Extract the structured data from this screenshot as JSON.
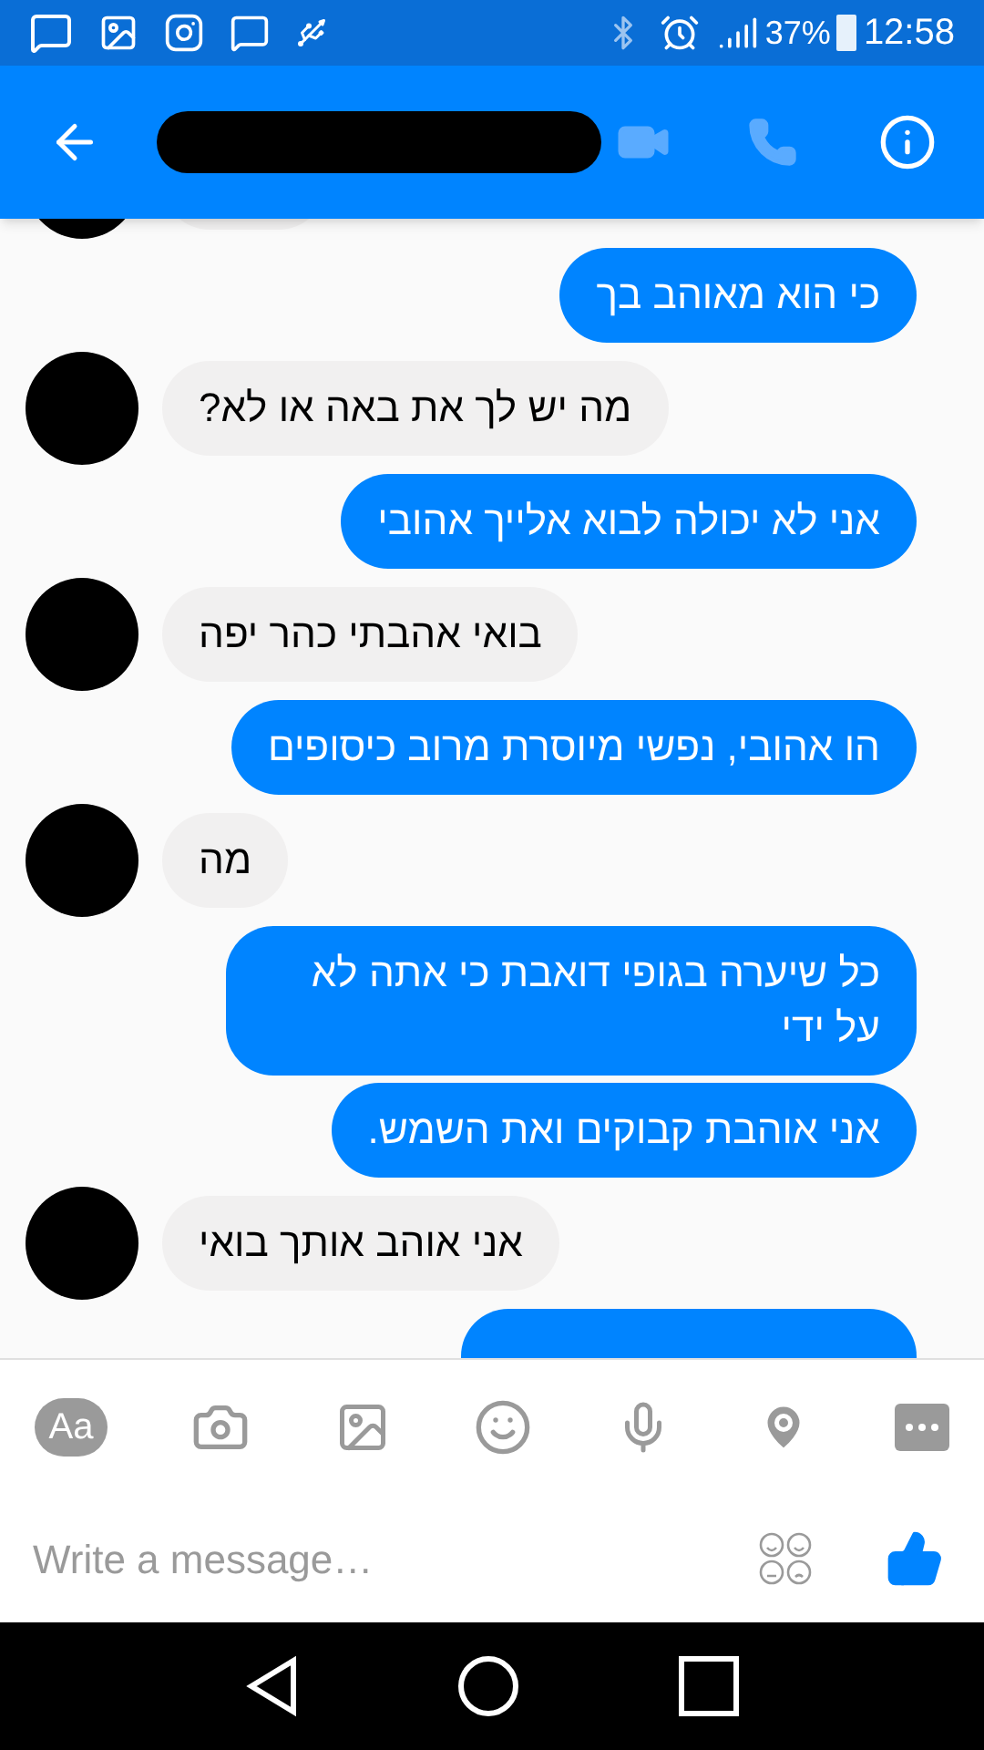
{
  "status_bar": {
    "battery": "37%",
    "time": "12:58"
  },
  "header": {
    "title_redacted": true
  },
  "messages": [
    {
      "kind": "in"
    },
    {
      "kind": "out",
      "text": "כי הוא מאוהב בך"
    },
    {
      "kind": "in",
      "text": "מה יש לך את באה או לא?"
    },
    {
      "kind": "out",
      "text": "אני לא יכולה לבוא אלייך אהובי"
    },
    {
      "kind": "in",
      "text": "בואי אהבתי כהר יפה"
    },
    {
      "kind": "out",
      "text": "הו אהובי, נפשי מיוסרת מרוב כיסופים"
    },
    {
      "kind": "in",
      "text": "מה"
    },
    {
      "kind": "out",
      "text": "כל שיערה בגופי דואבת כי אתה לא על ידי"
    },
    {
      "kind": "out",
      "text": "אני אוהבת קבוקים ואת השמש."
    },
    {
      "kind": "in",
      "text": "אני אוהב אותך בואי"
    },
    {
      "kind": "out"
    }
  ],
  "composer": {
    "aa": "Aa",
    "placeholder": "Write a message…"
  }
}
